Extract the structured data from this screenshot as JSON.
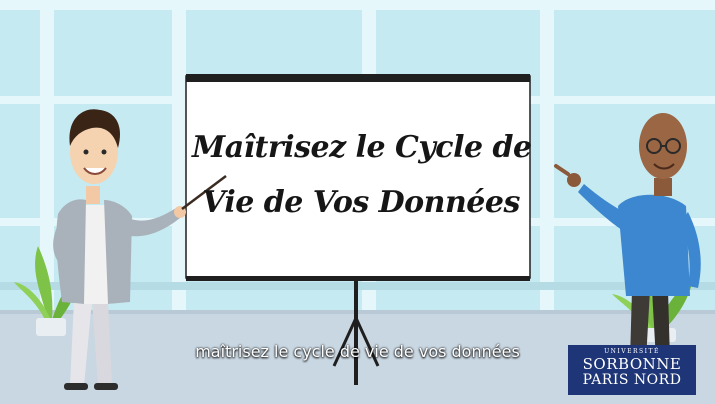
{
  "board": {
    "title_line1": "Maîtrisez le Cycle de",
    "title_line2": "Vie de Vos Données"
  },
  "caption": {
    "text": "maîtrisez le cycle de vie de vos données"
  },
  "logo": {
    "line1": "UNIVERSITÉ",
    "line2": "SORBONNE",
    "line3": "PARIS NORD"
  },
  "colors": {
    "wall": "#cfeff6",
    "floor": "#c9d7e2",
    "board_frame": "#1f1f1f",
    "logo_bg": "#1e3677",
    "caption_text": "#ffffff"
  }
}
